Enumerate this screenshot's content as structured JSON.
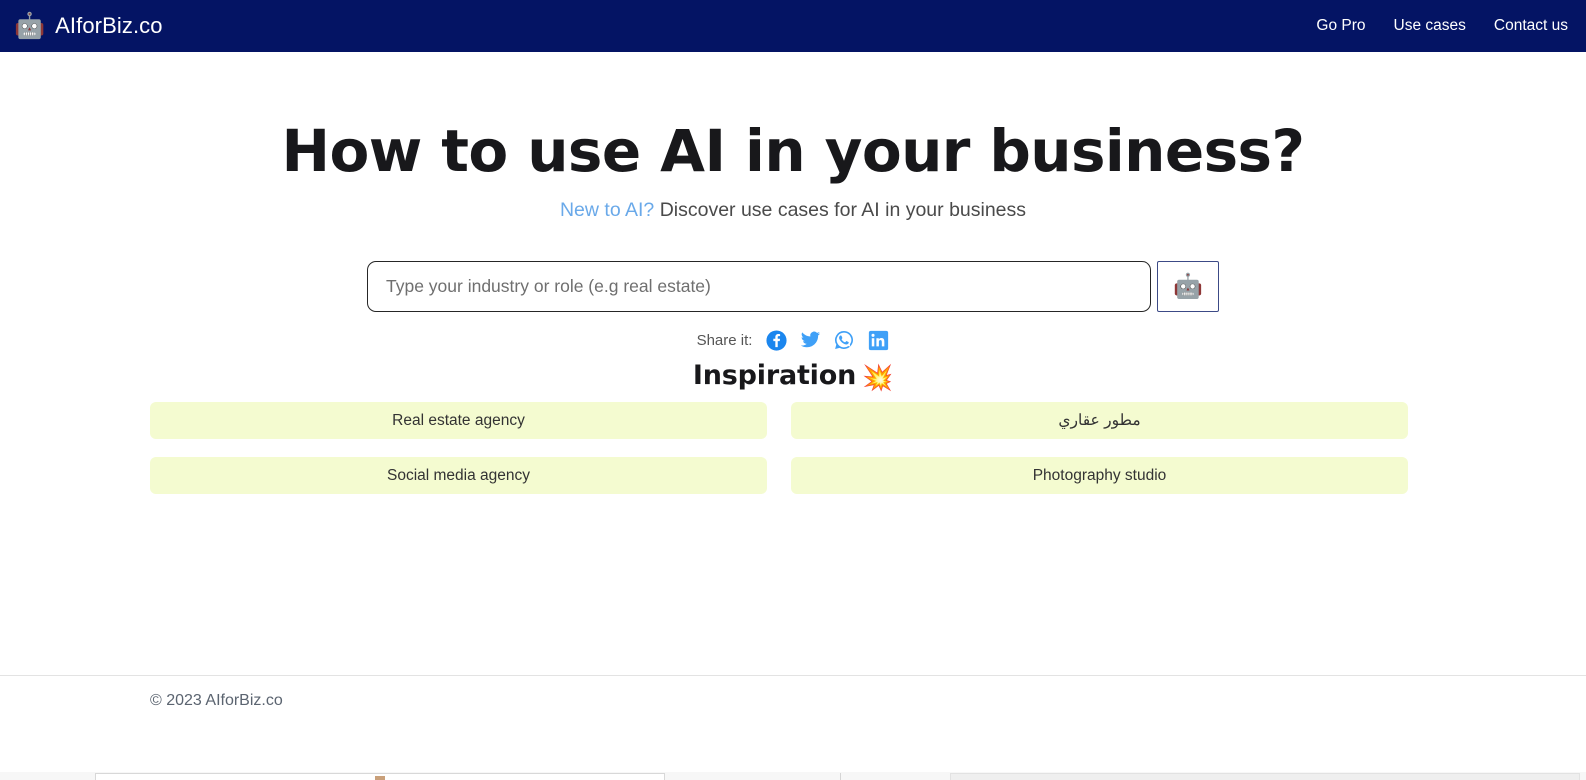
{
  "navbar": {
    "logo_icon": "robot-emoji",
    "logo_glyph": "🤖",
    "brand_name": "AIforBiz.co",
    "links": [
      {
        "label": "Go Pro"
      },
      {
        "label": "Use cases"
      },
      {
        "label": "Contact us"
      }
    ]
  },
  "hero": {
    "title": "How to use AI in your business?",
    "subtitle_link": "New to AI?",
    "subtitle_rest": " Discover use cases for AI in your business"
  },
  "search": {
    "placeholder": "Type your industry or role (e.g real estate)",
    "value": "",
    "button_icon": "robot-emoji",
    "button_glyph": "🤖"
  },
  "share": {
    "label": "Share it:",
    "icons": [
      {
        "name": "facebook-icon"
      },
      {
        "name": "twitter-icon"
      },
      {
        "name": "whatsapp-icon"
      },
      {
        "name": "linkedin-icon"
      }
    ]
  },
  "inspiration": {
    "heading": "Inspiration",
    "emoji": "💥",
    "chips": [
      {
        "label": "Real estate agency",
        "rtl": false
      },
      {
        "label": "مطور عقاري",
        "rtl": true
      },
      {
        "label": "Social media agency",
        "rtl": false
      },
      {
        "label": "Photography studio",
        "rtl": false
      }
    ]
  },
  "footer": {
    "copyright": "© 2023 AIforBiz.co"
  },
  "colors": {
    "navbar_bg": "#041464",
    "chip_bg": "#f4fbd0",
    "link_blue": "#6aa9e9",
    "social_blue": "#3fa0f7",
    "facebook_blue": "#1b86ee",
    "heading_dark": "#18181b"
  }
}
